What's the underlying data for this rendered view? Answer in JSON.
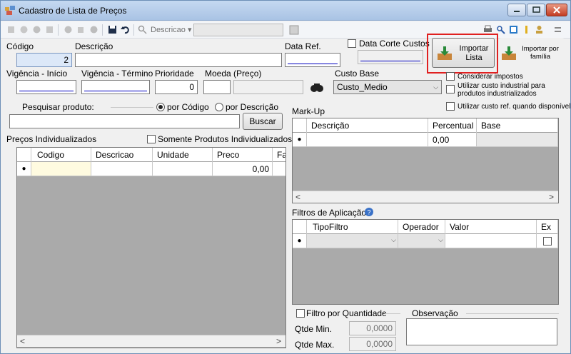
{
  "window": {
    "title": "Cadastro de Lista de Preços"
  },
  "toolbar": {
    "descricao_label": "Descricao ▾"
  },
  "form": {
    "codigo_label": "Código",
    "codigo_value": "2",
    "descricao_label": "Descrição",
    "data_ref_label": "Data Ref.",
    "data_ref_value": "__/__/____",
    "data_corte_label": "Data Corte Custos",
    "data_corte_value": "__/__/____",
    "vig_inicio_label": "Vigência - Início",
    "vig_inicio_value": "__/__/____",
    "vig_termino_label": "Vigência - Término",
    "vig_termino_value": "__/__/____",
    "prioridade_label": "Prioridade",
    "prioridade_value": "0",
    "moeda_label": "Moeda (Preço)",
    "custo_base_label": "Custo Base",
    "custo_base_value": "Custo_Medio"
  },
  "import_buttons": {
    "importar_lista": "Importar Lista",
    "importar_familia": "Importar por família"
  },
  "options": {
    "considerar_impostos": "Considerar impostos",
    "custo_industrial": "Utilizar custo industrial para produtos industrializados",
    "custo_ref": "Utilizar custo ref. quando disponível"
  },
  "search": {
    "label": "Pesquisar produto:",
    "por_codigo": "por Código",
    "por_descricao": "por Descrição",
    "buscar": "Buscar"
  },
  "precos": {
    "title": "Preços Individualizados",
    "somente": "Somente Produtos Individualizados",
    "columns": [
      "Codigo",
      "Descricao",
      "Unidade",
      "Preco",
      "Fa"
    ],
    "row_preco": "0,00"
  },
  "markup": {
    "title": "Mark-Up",
    "columns": [
      "Descrição",
      "Percentual",
      "Base"
    ],
    "row_percentual": "0,00"
  },
  "filtros": {
    "title": "Filtros de Aplicação",
    "columns": [
      "TipoFiltro",
      "Operador",
      "Valor",
      "Ex"
    ]
  },
  "quantidade": {
    "filtro_label": "Filtro por Quantidade",
    "min_label": "Qtde Min.",
    "min_value": "0,0000",
    "max_label": "Qtde Max.",
    "max_value": "0,0000"
  },
  "observacao": {
    "label": "Observação"
  },
  "colors": {
    "highlight": "#e02020",
    "selection_row": "#fffbe0"
  }
}
